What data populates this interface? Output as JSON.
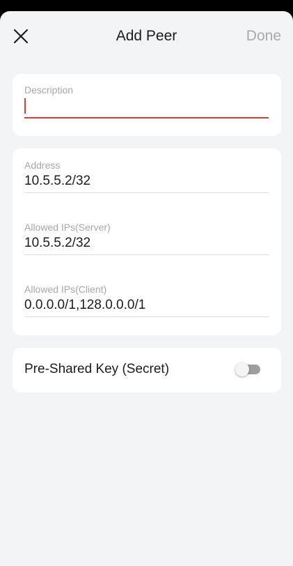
{
  "header": {
    "title": "Add Peer",
    "done_label": "Done",
    "close_icon": "close-icon"
  },
  "description": {
    "label": "Description",
    "value": ""
  },
  "network": {
    "address": {
      "label": "Address",
      "value": "10.5.5.2/32"
    },
    "allowed_ips_server": {
      "label": "Allowed IPs(Server)",
      "value": "10.5.5.2/32"
    },
    "allowed_ips_client": {
      "label": "Allowed IPs(Client)",
      "value": "0.0.0.0/1,128.0.0.0/1"
    }
  },
  "psk": {
    "label": "Pre-Shared Key (Secret)",
    "enabled": false
  },
  "colors": {
    "accent": "#d83b3b",
    "background": "#f3f4f6",
    "card": "#ffffff",
    "muted_text": "#a9a9ad"
  }
}
